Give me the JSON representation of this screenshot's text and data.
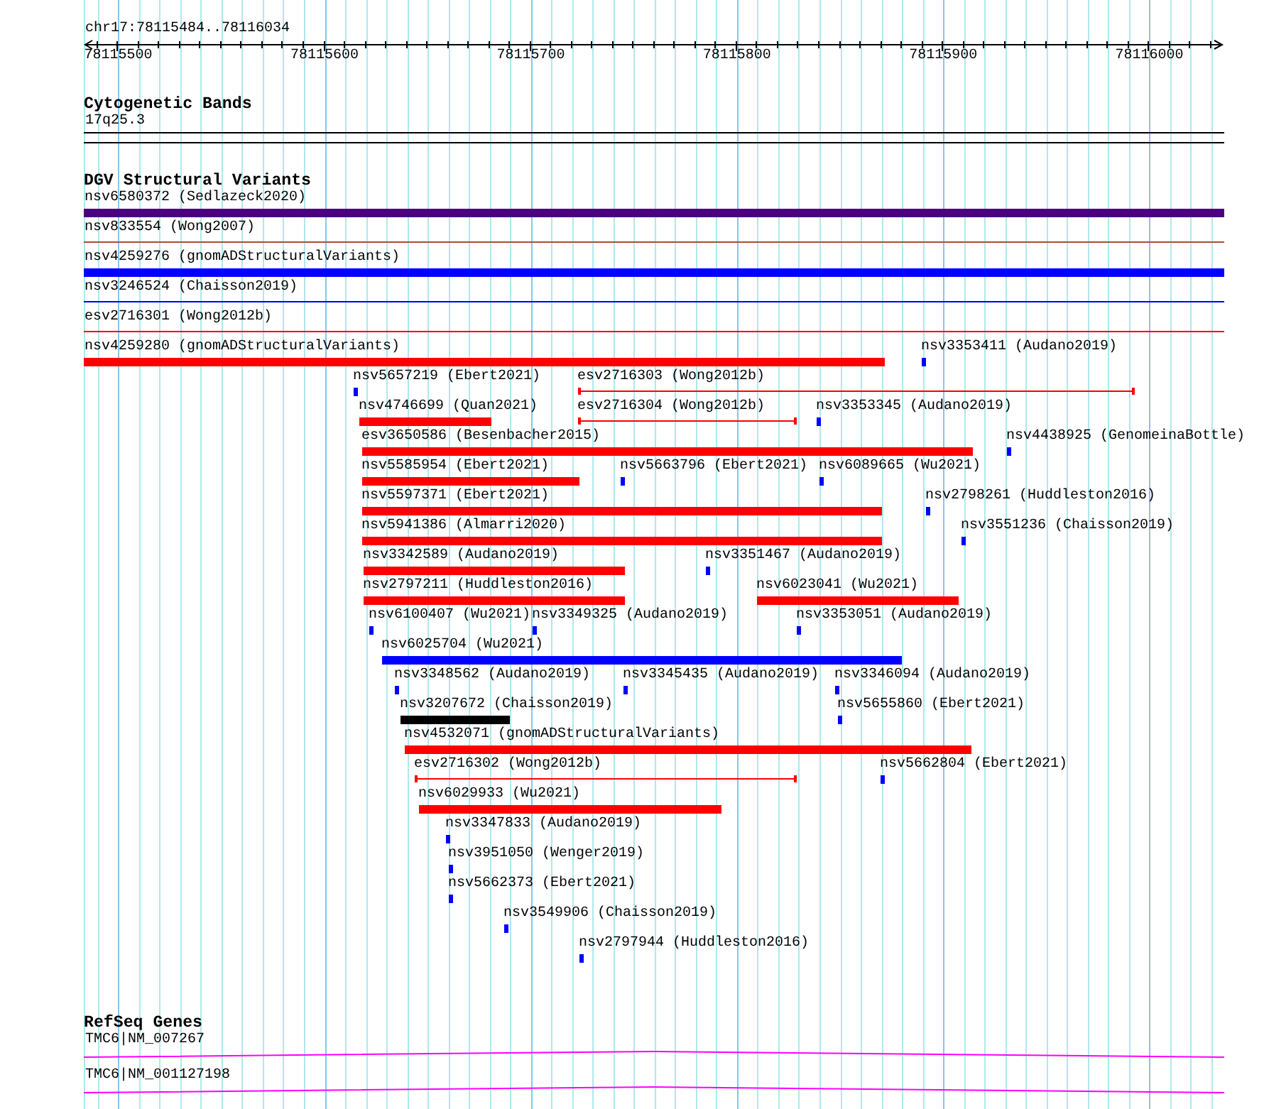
{
  "ruler": {
    "location": "chr17:78115484..78116034",
    "ticks": [
      "78115500",
      "78115600",
      "78115700",
      "78115800",
      "78115900",
      "78116000"
    ]
  },
  "tracks": [
    {
      "kind": "cytobands",
      "title": "Cytogenetic Bands",
      "features": [
        {
          "label": "17q25.3"
        }
      ]
    },
    {
      "kind": "variants",
      "title": "DGV Structural Variants",
      "rows": [
        {
          "features": [
            {
              "label": "nsv6580372 (Sedlazeck2020)",
              "kind": "bar",
              "color": "#4b0082"
            }
          ]
        },
        {
          "features": [
            {
              "label": "nsv833554 (Wong2007)",
              "kind": "line",
              "color": "#a0522d"
            }
          ]
        },
        {
          "features": [
            {
              "label": "nsv4259276 (gnomADStructuralVariants)",
              "kind": "bar",
              "color": "#0000ff"
            }
          ]
        },
        {
          "features": [
            {
              "label": "nsv3246524 (Chaisson2019)",
              "kind": "line",
              "color": "#0000ff"
            }
          ]
        },
        {
          "features": [
            {
              "label": "esv2716301 (Wong2012b)",
              "kind": "line",
              "color": "#ff0000"
            }
          ]
        },
        {
          "features": [
            {
              "label": "nsv4259280 (gnomADStructuralVariants)",
              "kind": "bar",
              "color": "#ff0000"
            },
            {
              "label": "nsv3353411 (Audano2019)",
              "kind": "bar",
              "color": "#0000ff"
            }
          ]
        },
        {
          "features": [
            {
              "label": "nsv5657219 (Ebert2021)",
              "kind": "bar",
              "color": "#0000ff"
            },
            {
              "label": "esv2716303 (Wong2012b)",
              "kind": "capped",
              "color": "#ff0000"
            }
          ]
        },
        {
          "features": [
            {
              "label": "nsv4746699 (Quan2021)",
              "kind": "bar",
              "color": "#ff0000"
            },
            {
              "label": "esv2716304 (Wong2012b)",
              "kind": "capped",
              "color": "#ff0000"
            },
            {
              "label": "nsv3353345 (Audano2019)",
              "kind": "bar",
              "color": "#0000ff"
            }
          ]
        },
        {
          "features": [
            {
              "label": "esv3650586 (Besenbacher2015)",
              "kind": "bar",
              "color": "#ff0000"
            },
            {
              "label": "nsv4438925 (GenomeinaBottle)",
              "kind": "bar",
              "color": "#0000ff"
            }
          ]
        },
        {
          "features": [
            {
              "label": "nsv5585954 (Ebert2021)",
              "kind": "bar",
              "color": "#ff0000"
            },
            {
              "label": "nsv5663796 (Ebert2021)",
              "kind": "bar",
              "color": "#0000ff"
            },
            {
              "label": "nsv6089665 (Wu2021)",
              "kind": "bar",
              "color": "#0000ff"
            }
          ]
        },
        {
          "features": [
            {
              "label": "nsv5597371 (Ebert2021)",
              "kind": "bar",
              "color": "#ff0000"
            },
            {
              "label": "nsv2798261 (Huddleston2016)",
              "kind": "bar",
              "color": "#0000ff"
            }
          ]
        },
        {
          "features": [
            {
              "label": "nsv5941386 (Almarri2020)",
              "kind": "bar",
              "color": "#ff0000"
            },
            {
              "label": "nsv3551236 (Chaisson2019)",
              "kind": "bar",
              "color": "#0000ff"
            }
          ]
        },
        {
          "features": [
            {
              "label": "nsv3342589 (Audano2019)",
              "kind": "bar",
              "color": "#ff0000"
            },
            {
              "label": "nsv3351467 (Audano2019)",
              "kind": "bar",
              "color": "#0000ff"
            }
          ]
        },
        {
          "features": [
            {
              "label": "nsv2797211 (Huddleston2016)",
              "kind": "bar",
              "color": "#ff0000"
            },
            {
              "label": "nsv6023041 (Wu2021)",
              "kind": "bar",
              "color": "#ff0000"
            }
          ]
        },
        {
          "features": [
            {
              "label": "nsv6100407 (Wu2021)",
              "kind": "bar",
              "color": "#0000ff"
            },
            {
              "label": "nsv3349325 (Audano2019)",
              "kind": "bar",
              "color": "#0000ff"
            },
            {
              "label": "nsv3353051 (Audano2019)",
              "kind": "bar",
              "color": "#0000ff"
            }
          ]
        },
        {
          "features": [
            {
              "label": "nsv6025704 (Wu2021)",
              "kind": "bar",
              "color": "#0000ff"
            }
          ]
        },
        {
          "features": [
            {
              "label": "nsv3348562 (Audano2019)",
              "kind": "bar",
              "color": "#0000ff"
            },
            {
              "label": "nsv3345435 (Audano2019)",
              "kind": "bar",
              "color": "#0000ff"
            },
            {
              "label": "nsv3346094 (Audano2019)",
              "kind": "bar",
              "color": "#0000ff"
            }
          ]
        },
        {
          "features": [
            {
              "label": "nsv3207672 (Chaisson2019)",
              "kind": "bar",
              "color": "#000000"
            },
            {
              "label": "nsv5655860 (Ebert2021)",
              "kind": "bar",
              "color": "#0000ff"
            }
          ]
        },
        {
          "features": [
            {
              "label": "nsv4532071 (gnomADStructuralVariants)",
              "kind": "bar",
              "color": "#ff0000"
            }
          ]
        },
        {
          "features": [
            {
              "label": "esv2716302 (Wong2012b)",
              "kind": "capped",
              "color": "#ff0000"
            },
            {
              "label": "nsv5662804 (Ebert2021)",
              "kind": "bar",
              "color": "#0000ff"
            }
          ]
        },
        {
          "features": [
            {
              "label": "nsv6029933 (Wu2021)",
              "kind": "bar",
              "color": "#ff0000"
            }
          ]
        },
        {
          "features": [
            {
              "label": "nsv3347833 (Audano2019)",
              "kind": "bar",
              "color": "#0000ff"
            }
          ]
        },
        {
          "features": [
            {
              "label": "nsv3951050 (Wenger2019)",
              "kind": "bar",
              "color": "#0000ff"
            }
          ]
        },
        {
          "features": [
            {
              "label": "nsv5662373 (Ebert2021)",
              "kind": "bar",
              "color": "#0000ff"
            }
          ]
        },
        {
          "features": [
            {
              "label": "nsv3549906 (Chaisson2019)",
              "kind": "bar",
              "color": "#0000ff"
            }
          ]
        },
        {
          "features": [
            {
              "label": "nsv2797944 (Huddleston2016)",
              "kind": "bar",
              "color": "#0000ff"
            }
          ]
        }
      ]
    },
    {
      "kind": "genes",
      "title": "RefSeq Genes",
      "features": [
        {
          "label": "TMC6|NM_007267"
        },
        {
          "label": "TMC6|NM_001127198"
        }
      ]
    }
  ]
}
